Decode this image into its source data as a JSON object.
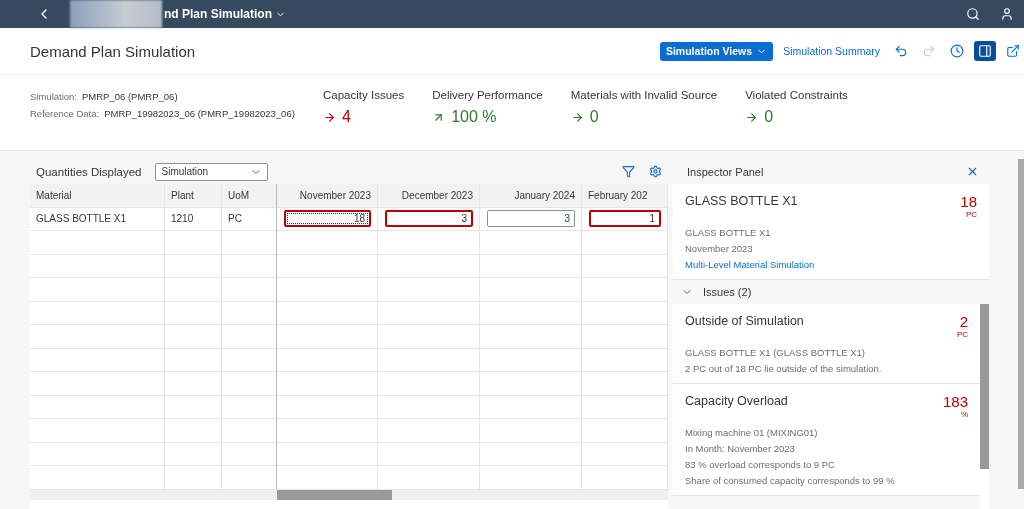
{
  "shell": {
    "title": "nd Plan Simulation"
  },
  "header": {
    "title": "Demand Plan Simulation",
    "actions": [
      {
        "kind": "menu",
        "label": "Simulation Views"
      },
      {
        "kind": "link",
        "label": "Simulation Summary"
      },
      {
        "kind": "undo",
        "disabled": false
      },
      {
        "kind": "redo",
        "disabled": true
      },
      {
        "kind": "history",
        "disabled": false
      },
      {
        "kind": "panel",
        "selected": true
      },
      {
        "kind": "share",
        "disabled": false
      }
    ]
  },
  "info": [
    {
      "label": "Simulation:",
      "value": "PMRP_06 (PMRP_06)"
    },
    {
      "label": "Reference Data:",
      "value": "PMRP_19982023_06 (PMRP_19982023_06)"
    }
  ],
  "kpis": [
    {
      "title": "Capacity Issues",
      "kind": "steady",
      "color": "#bb0000",
      "value": "4"
    },
    {
      "title": "Delivery Performance",
      "kind": "rising",
      "color": "#2b7d2b",
      "value": "100 %"
    },
    {
      "title": "Materials with Invalid Source",
      "kind": "steady",
      "color": "#2b7d2b",
      "value": "0"
    },
    {
      "title": "Violated Constraints",
      "kind": "steady",
      "color": "#2b7d2b",
      "value": "0"
    }
  ],
  "table": {
    "quantities_label": "Quantities Displayed",
    "quantities_select": "Simulation",
    "fixed_columns": [
      "Material",
      "Plant",
      "UoM"
    ],
    "period_columns": [
      "November 2023",
      "December 2023",
      "January 2024",
      "February 202"
    ],
    "rows": [
      {
        "material": "GLASS BOTTLE X1",
        "plant": "1210",
        "uom": "PC",
        "cells": [
          {
            "value": "18",
            "error": true,
            "focused": true
          },
          {
            "value": "3",
            "error": true,
            "focused": false
          },
          {
            "value": "3",
            "error": false,
            "focused": false
          },
          {
            "value": "1",
            "error": true,
            "focused": false
          }
        ]
      }
    ]
  },
  "inspector": {
    "title": "Inspector Panel",
    "summary": {
      "title": "GLASS BOTTLE X1",
      "value": "18",
      "unit": "PC",
      "lines": [
        "GLASS BOTTLE X1",
        "November 2023"
      ],
      "link": "Multi-Level Material Simulation"
    },
    "issues": {
      "label": "Issues (2)",
      "expanded": true,
      "items": [
        {
          "title": "Outside of Simulation",
          "value": "2",
          "unit": "PC",
          "lines": [
            "GLASS BOTTLE X1 (GLASS BOTTLE X1)",
            "2 PC out of 18 PC lie outside of the simulation."
          ]
        },
        {
          "title": "Capacity Overload",
          "value": "183",
          "unit": "%",
          "lines": [
            "Mixing machine 01 (MIXING01)",
            "In Month: November 2023",
            "83 % overload corresponds to 9 PC",
            "Share of consumed capacity corresponds to 99 %"
          ]
        }
      ]
    }
  }
}
